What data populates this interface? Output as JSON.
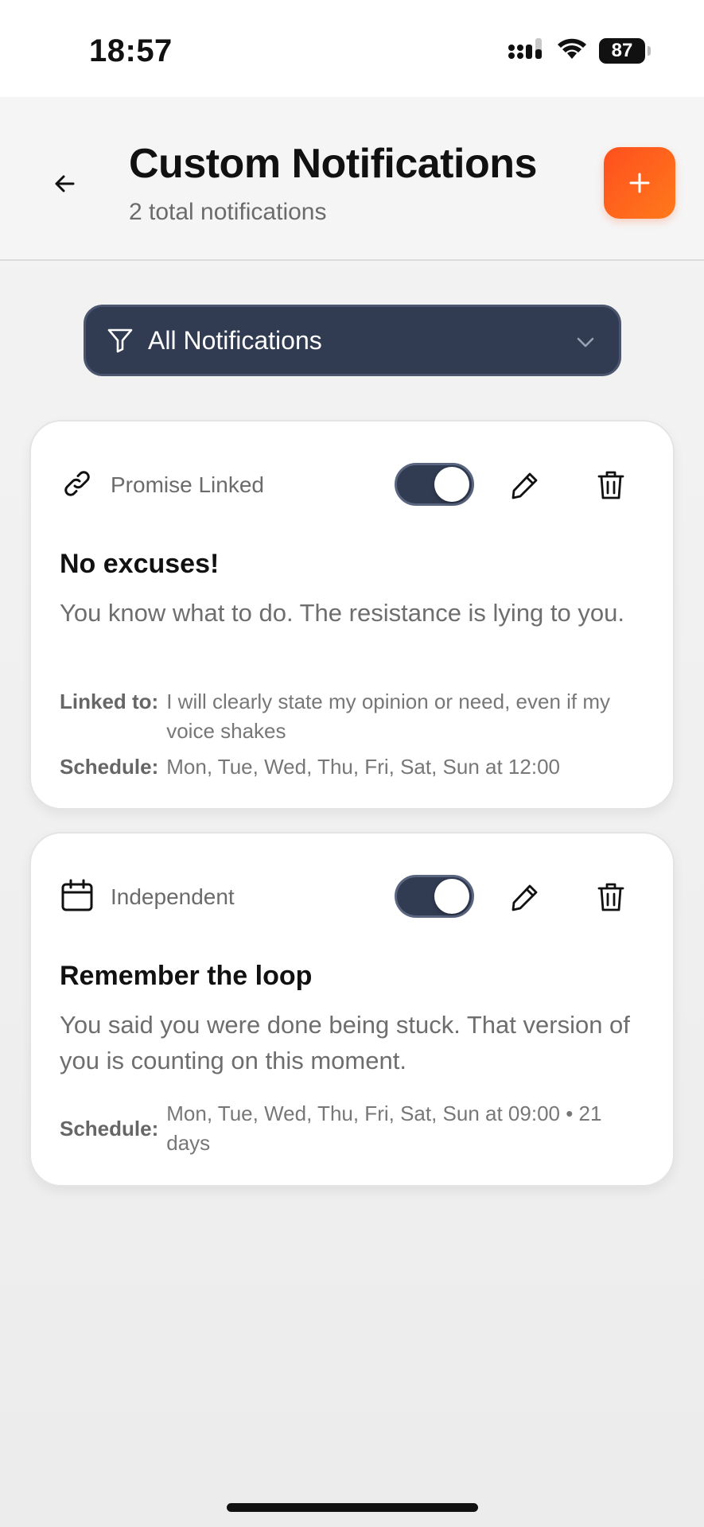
{
  "status_bar": {
    "time": "18:57",
    "battery": "87",
    "icons": [
      "signal-icon",
      "wifi-icon",
      "battery-icon"
    ]
  },
  "header": {
    "title": "Custom Notifications",
    "subtitle": "2 total notifications",
    "back_icon": "arrow-left-icon",
    "add_icon": "plus-icon"
  },
  "filter": {
    "selected": "All Notifications",
    "icon": "filter-icon",
    "chevron": "chevron-down-icon"
  },
  "notifications": [
    {
      "type_icon": "link-icon",
      "type_label": "Promise Linked",
      "enabled": true,
      "title": "No excuses!",
      "message": "You know what to do. The resistance is lying to you.",
      "linked_key": "Linked to:",
      "linked_value": "I will clearly state my opinion or need, even if my voice shakes",
      "schedule_key": "Schedule:",
      "schedule_value": "Mon, Tue, Wed, Thu, Fri, Sat, Sun at 12:00"
    },
    {
      "type_icon": "calendar-icon",
      "type_label": "Independent",
      "enabled": true,
      "title": "Remember the loop",
      "message": "You said you were done being stuck. That version of you is counting on this moment.",
      "schedule_key": "Schedule:",
      "schedule_value": "Mon, Tue, Wed, Thu, Fri, Sat, Sun at 09:00 • 21 days"
    }
  ],
  "colors": {
    "accent": "#ff5a1f",
    "dark": "#313c52",
    "muted_text": "#6e6e6e"
  }
}
